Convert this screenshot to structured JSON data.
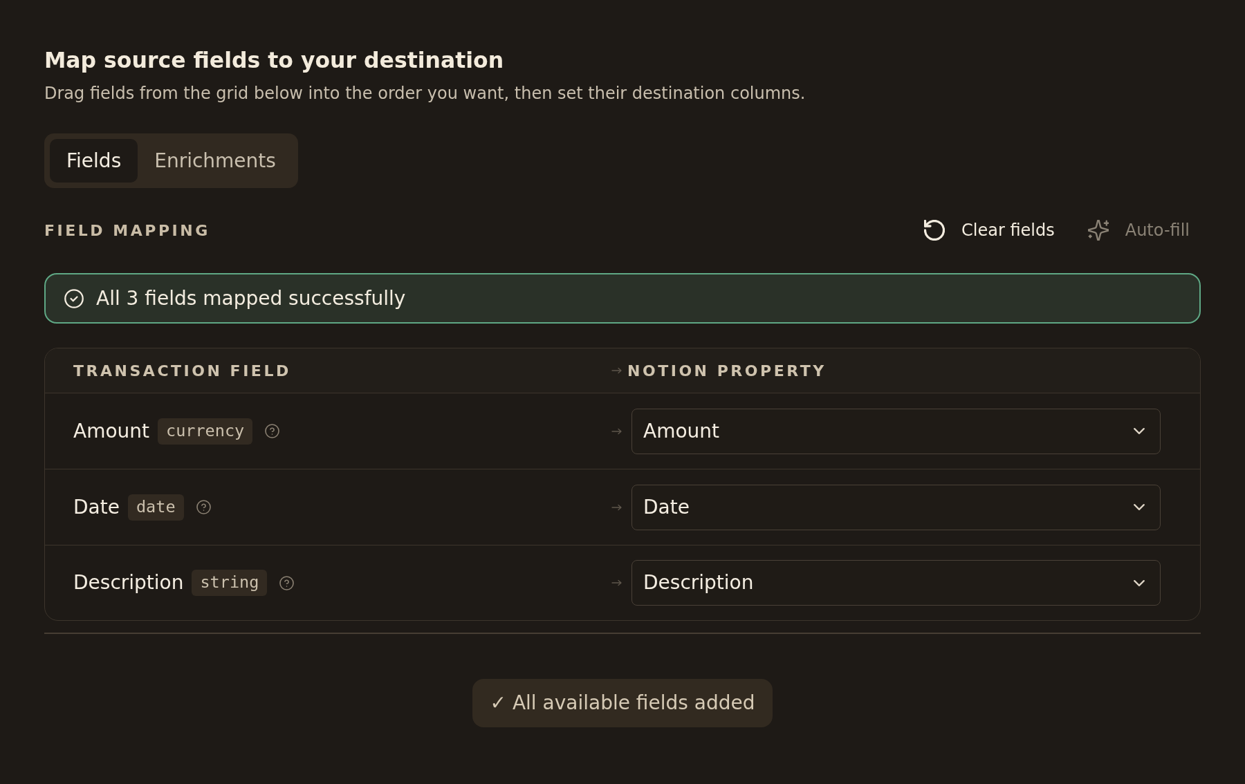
{
  "header": {
    "title": "Map source fields to your destination",
    "subtitle": "Drag fields from the grid below into the order you want, then set their destination columns."
  },
  "tabs": [
    {
      "label": "Fields",
      "selected": true
    },
    {
      "label": "Enrichments",
      "selected": false
    }
  ],
  "mapping": {
    "title": "FIELD MAPPING",
    "actions": [
      {
        "label": "Clear fields",
        "kind": "reset",
        "disabled": false
      },
      {
        "label": "Auto-fill",
        "kind": "sparkle",
        "disabled": true
      }
    ],
    "banner": {
      "text": "All 3 fields mapped successfully"
    },
    "table": {
      "columns": [
        "TRANSACTION FIELD",
        "NOTION PROPERTY"
      ],
      "rows": [
        {
          "field": "Amount",
          "type": "currency",
          "property": "Amount"
        },
        {
          "field": "Date",
          "type": "date",
          "property": "Date"
        },
        {
          "field": "Description",
          "type": "string",
          "property": "Description"
        }
      ]
    }
  },
  "footer": {
    "button": "✓ All available fields added"
  }
}
